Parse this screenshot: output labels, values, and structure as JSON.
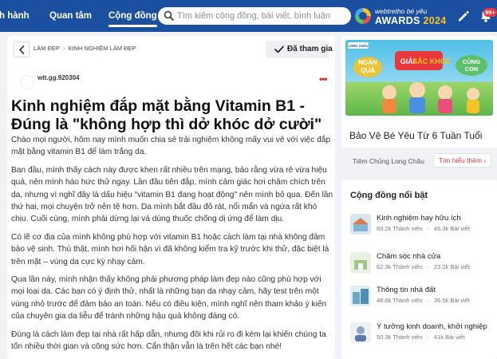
{
  "nav": {
    "items": [
      {
        "label": "h hành",
        "active": false
      },
      {
        "label": "Quan tâm",
        "active": false
      },
      {
        "label": "Cộng đồng",
        "active": true
      }
    ],
    "search_placeholder": "Tìm kiếm cộng đồng, bài viết, bình luận",
    "awards": {
      "line1_brand": "webtretho",
      "line1_rest": " bé yêu",
      "line2_a": "AWARDS ",
      "line2_b": "2024"
    },
    "notification_count": "99+"
  },
  "breadcrumb": {
    "items": [
      "LÀM ĐẸP",
      "KINH NGHIỆM LÀM ĐẸP"
    ]
  },
  "join_button": {
    "label": "Đã tham gia"
  },
  "author": {
    "name": "wtt.gg.920304"
  },
  "post": {
    "title": "Kinh nghiệm đắp mặt bằng Vitamin B1 - Đúng là \"không hợp thì dở khóc dở cười\"",
    "paragraphs": [
      "Chào mọi người, hôm nay mình muốn chia sẻ trải nghiệm không mấy vui vẻ với việc đắp mặt bằng vitamin B1 để làm trắng da.",
      "Ban đầu, mình thấy cách này được khen rất nhiều trên mạng, bảo rằng vừa rẻ vừa hiệu quả, nên mình háo hức thử ngay. Lần đầu tiên đắp, mình cảm giác hơi châm chích trên da, nhưng vì nghĩ đây là dấu hiệu \"vitamin B1 đang hoạt động\" nên mình bỏ qua. Đến lần thứ hai, mọi chuyện trở nên tệ hơn. Da mình bắt đầu đỏ rát, nổi mẩn và ngứa rất khó chịu. Cuối cùng, mình phải dừng lại và dùng thuốc chống dị ứng để làm dịu.",
      "Có lẽ cơ địa của mình không phù hợp với vitamin B1 hoặc cách làm tại nhà không đảm bảo vệ sinh. Thú thật, mình hơi hối hận vì đã không kiểm tra kỹ trước khi thử, đặc biệt là trên mặt – vùng da cực kỳ nhạy cảm.",
      "Qua lần này, mình nhận thấy không phải phương pháp làm đẹp nào cũng phù hợp với mọi loại da. Các bạn có ý định thử, nhất là những bạn da nhạy cảm, hãy test trên một vùng nhỏ trước để đảm bảo an toàn. Nếu có điều kiện, mình nghĩ nên tham khảo ý kiến của chuyên gia da liễu để tránh những hậu quả không đáng có.",
      "Đúng là cách làm đẹp tại nhà rất hấp dẫn, nhưng đôi khi rủi ro đi kèm lại khiến chúng ta tốn nhiều thời gian và công sức hơn. Cẩn thận vẫn là trên hết các bạn nhé!"
    ]
  },
  "ad": {
    "banner_text": {
      "ngan": "NGÀN",
      "qua": "QUÀ",
      "giai": "GIẢI",
      "sac": "SẮC",
      "khoe": "KHOẺ",
      "cung": "CÙNG",
      "con": "CON",
      "pharmacy": "LONG CHÂU",
      "pharmacy_sub": "PHARMACY"
    },
    "title": "Bảo Vệ Bé Yêu Từ 6 Tuần Tuổi",
    "sponsor": "Tiêm Chủng Long Châu",
    "cta": "Tìm hiểu thêm",
    "cta_arrow": "›"
  },
  "communities": {
    "title": "Cộng đồng nổi bật",
    "items": [
      {
        "name": "Kinh nghiệm hay hữu ích",
        "members": "83.2k Thành viên",
        "posts": "46.3k Bài viết"
      },
      {
        "name": "Chăm sóc nhà cửa",
        "members": "62.3k Thành viên",
        "posts": "23.2k Bài viết"
      },
      {
        "name": "Thông tin nhà đất",
        "members": "48.6k Thành viên",
        "posts": "36.5k Bài viết"
      },
      {
        "name": "Ý tưởng kinh doanh, khởi nghiệp",
        "members": "50.3k Thành viên",
        "posts": "41k Bài viết"
      }
    ]
  },
  "colors": {
    "nav_bg": "#1b4f9f",
    "accent_red": "#d23b3b",
    "awards_gold": "#f7c224",
    "page_bg": "#f0f2f5"
  }
}
